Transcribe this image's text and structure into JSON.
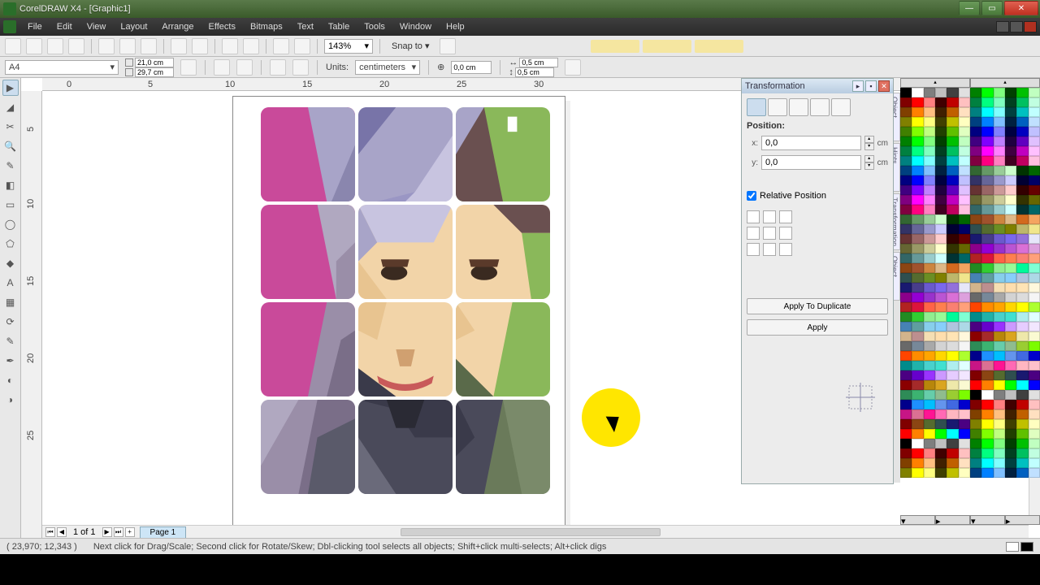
{
  "title": "CorelDRAW X4 - [Graphic1]",
  "menus": [
    "File",
    "Edit",
    "View",
    "Layout",
    "Arrange",
    "Effects",
    "Bitmaps",
    "Text",
    "Table",
    "Tools",
    "Window",
    "Help"
  ],
  "toolbar": {
    "zoom": "143%",
    "snap": "Snap to"
  },
  "props": {
    "page_size": "A4",
    "width": "21,0 cm",
    "height": "29,7 cm",
    "units_label": "Units:",
    "units": "centimeters",
    "nudge": "0,0 cm",
    "dup_x": "0,5 cm",
    "dup_y": "0,5 cm"
  },
  "ruler": {
    "unit": "centimeters",
    "h_marks": [
      "0",
      "5",
      "10",
      "15",
      "20",
      "25",
      "30"
    ],
    "v_marks": [
      "5",
      "10",
      "15",
      "20",
      "25"
    ]
  },
  "page_nav": {
    "text": "1 of 1",
    "tab": "Page 1"
  },
  "panel": {
    "title": "Transformation",
    "position_label": "Position:",
    "x_label": "x:",
    "x_val": "0,0",
    "x_unit": "cm",
    "y_label": "y:",
    "y_val": "0,0",
    "y_unit": "cm",
    "rel_label": "Relative Position",
    "apply_dup": "Apply To Duplicate",
    "apply": "Apply"
  },
  "dockers": [
    "Object Manager",
    "Hints",
    "Transformation",
    "Object Properties"
  ],
  "status": {
    "coords": "( 23,970; 12,343 )",
    "hint": "Next click for Drag/Scale; Second click for Rotate/Skew; Dbl-clicking tool selects all objects; Shift+click multi-selects; Alt+click digs"
  },
  "palette_colors": [
    "#000000",
    "#ffffff",
    "#7f7f7f",
    "#c0c0c0",
    "#404040",
    "#e0e0e0",
    "#800000",
    "#ff0000",
    "#ff8080",
    "#400000",
    "#c00000",
    "#ffc0c0",
    "#804000",
    "#ff8000",
    "#ffc080",
    "#402000",
    "#c06000",
    "#ffe0c0",
    "#808000",
    "#ffff00",
    "#ffff80",
    "#404000",
    "#c0c000",
    "#ffffc0",
    "#408000",
    "#80ff00",
    "#c0ff80",
    "#204000",
    "#60c000",
    "#e0ffc0",
    "#008000",
    "#00ff00",
    "#80ff80",
    "#004000",
    "#00c000",
    "#c0ffc0",
    "#008040",
    "#00ff80",
    "#80ffc0",
    "#004020",
    "#00c060",
    "#c0ffe0",
    "#008080",
    "#00ffff",
    "#80ffff",
    "#004040",
    "#00c0c0",
    "#c0ffff",
    "#004080",
    "#0080ff",
    "#80c0ff",
    "#002040",
    "#0060c0",
    "#c0e0ff",
    "#000080",
    "#0000ff",
    "#8080ff",
    "#000040",
    "#0000c0",
    "#c0c0ff",
    "#400080",
    "#8000ff",
    "#c080ff",
    "#200040",
    "#6000c0",
    "#e0c0ff",
    "#800080",
    "#ff00ff",
    "#ff80ff",
    "#400040",
    "#c000c0",
    "#ffc0ff",
    "#800040",
    "#ff0080",
    "#ff80c0",
    "#400020",
    "#c00060",
    "#ffc0e0",
    "#336633",
    "#669966",
    "#99cc99",
    "#ccffcc",
    "#003300",
    "#006600",
    "#333366",
    "#666699",
    "#9999cc",
    "#ccccff",
    "#000033",
    "#000066",
    "#663333",
    "#996666",
    "#cc9999",
    "#ffcccc",
    "#330000",
    "#660000",
    "#666633",
    "#999966",
    "#cccc99",
    "#ffffcc",
    "#333300",
    "#666600",
    "#336666",
    "#669999",
    "#99cccc",
    "#ccffff",
    "#003333",
    "#006666",
    "#8b4513",
    "#a0522d",
    "#cd853f",
    "#deb887",
    "#d2691e",
    "#f4a460",
    "#2f4f4f",
    "#556b2f",
    "#6b8e23",
    "#808000",
    "#bdb76b",
    "#f0e68c",
    "#191970",
    "#483d8b",
    "#6a5acd",
    "#7b68ee",
    "#9370db",
    "#e6e6fa",
    "#8b008b",
    "#9400d3",
    "#9932cc",
    "#ba55d3",
    "#da70d6",
    "#dda0dd",
    "#b22222",
    "#dc143c",
    "#ff6347",
    "#ff7f50",
    "#fa8072",
    "#ffa07a",
    "#228b22",
    "#32cd32",
    "#90ee90",
    "#98fb98",
    "#00fa9a",
    "#7fffd4",
    "#4682b4",
    "#5f9ea0",
    "#87ceeb",
    "#87cefa",
    "#b0c4de",
    "#add8e6",
    "#d2b48c",
    "#bc8f8f",
    "#f5deb3",
    "#ffdead",
    "#ffe4b5",
    "#fff8dc",
    "#696969",
    "#778899",
    "#a9a9a9",
    "#d3d3d3",
    "#dcdcdc",
    "#f5f5f5",
    "#ff4500",
    "#ff8c00",
    "#ffa500",
    "#ffd700",
    "#ffff00",
    "#adff2f",
    "#008b8b",
    "#20b2aa",
    "#48d1cc",
    "#40e0d0",
    "#afeeee",
    "#e0ffff",
    "#4b0082",
    "#6600cc",
    "#9933ff",
    "#cc99ff",
    "#e6ccff",
    "#f2e6ff",
    "#8b0000",
    "#a52a2a",
    "#b8860b",
    "#daa520",
    "#eee8aa",
    "#fafad2",
    "#2e8b57",
    "#3cb371",
    "#66cdaa",
    "#8fbc8f",
    "#9acd32",
    "#7cfc00",
    "#00008b",
    "#1e90ff",
    "#00bfff",
    "#6495ed",
    "#4169e1",
    "#0000cd",
    "#c71585",
    "#db7093",
    "#ff1493",
    "#ff69b4",
    "#ffb6c1",
    "#ffc0cb",
    "#800000",
    "#8b4513",
    "#556b2f",
    "#2f4f4f",
    "#191970",
    "#4b0082",
    "#ff0000",
    "#ff8000",
    "#ffff00",
    "#00ff00",
    "#00ffff",
    "#0000ff"
  ]
}
